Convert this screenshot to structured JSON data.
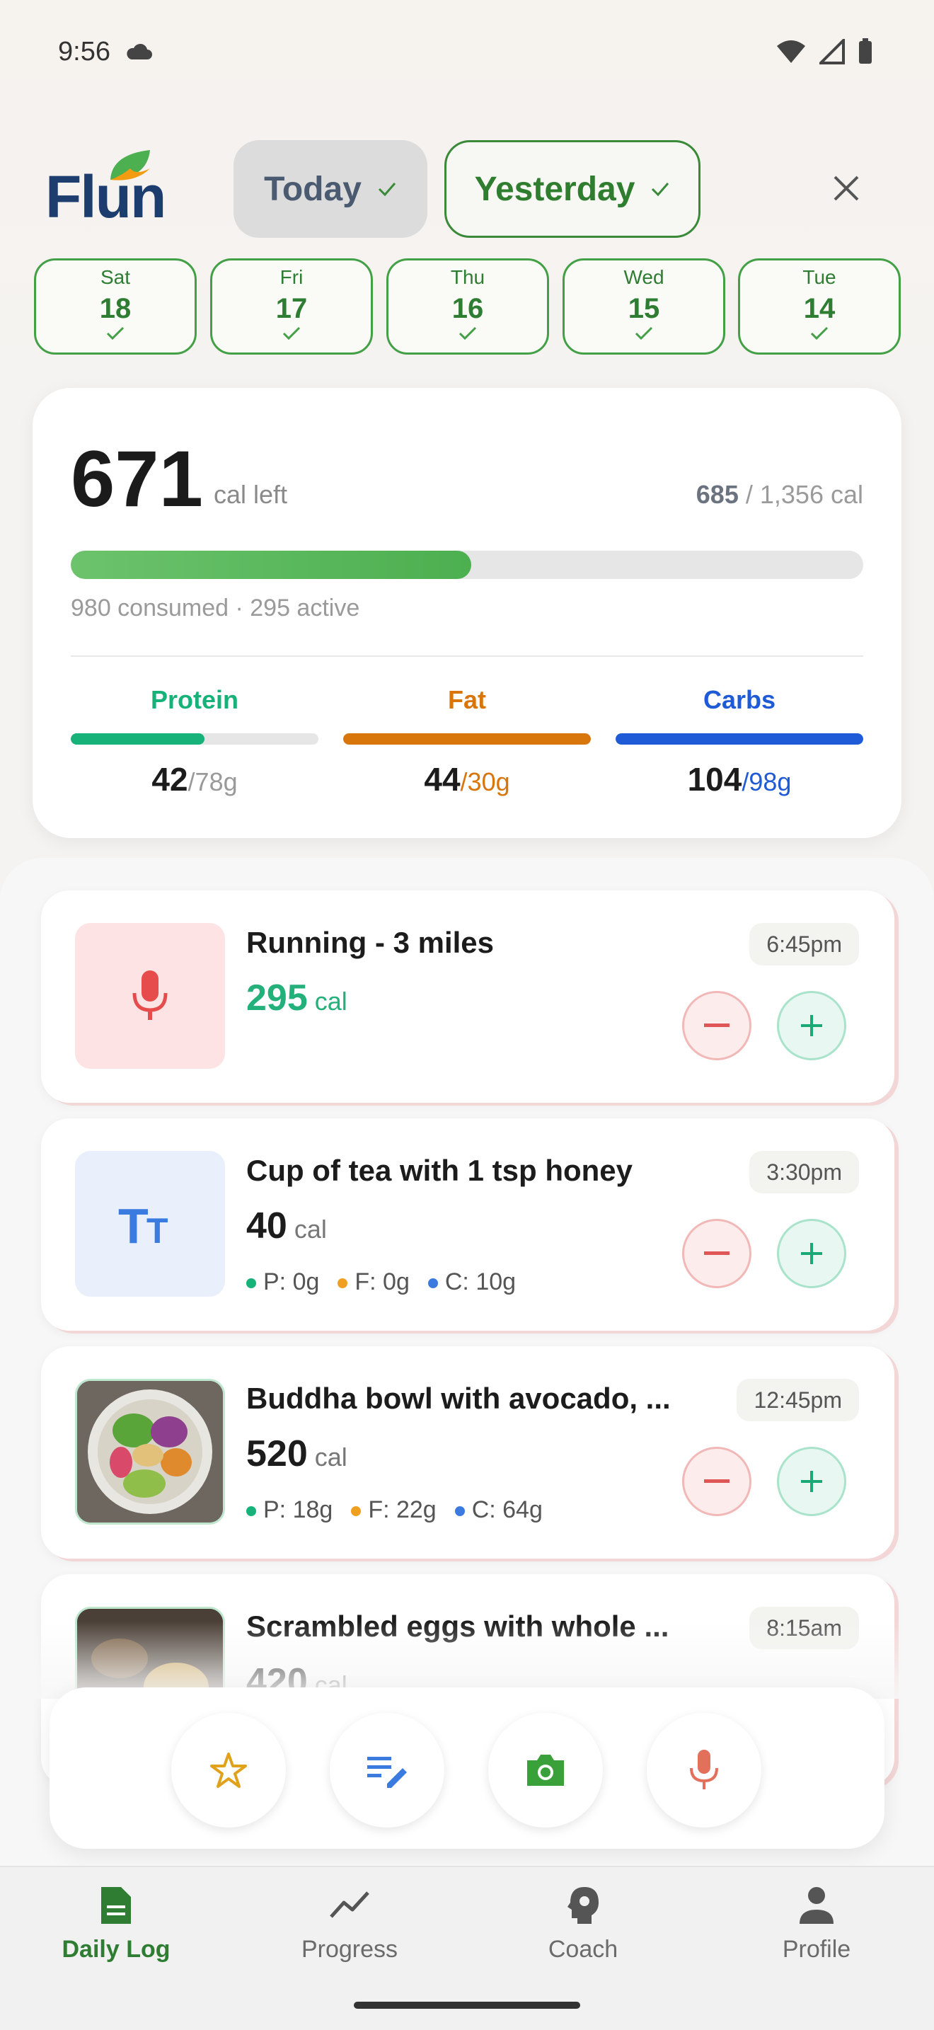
{
  "status_bar": {
    "time": "9:56"
  },
  "header": {
    "logo_text": "Flun",
    "tabs": [
      {
        "label": "Today"
      },
      {
        "label": "Yesterday"
      }
    ]
  },
  "days": [
    {
      "dow": "Sat",
      "num": "18"
    },
    {
      "dow": "Fri",
      "num": "17"
    },
    {
      "dow": "Thu",
      "num": "16"
    },
    {
      "dow": "Wed",
      "num": "15"
    },
    {
      "dow": "Tue",
      "num": "14"
    }
  ],
  "summary": {
    "calories_left": "671",
    "cal_left_label": "cal left",
    "net": "685",
    "goal": "/ 1,356 cal",
    "progress_fraction": 0.505,
    "consumed_text": "980 consumed · 295 active",
    "macros": [
      {
        "label": "Protein",
        "value": "42",
        "goal": "/78g",
        "fraction": 0.54,
        "color": "#16b27a"
      },
      {
        "label": "Fat",
        "value": "44",
        "goal": "/30g",
        "fraction": 1.0,
        "color": "#d9760b"
      },
      {
        "label": "Carbs",
        "value": "104",
        "goal": "/98g",
        "fraction": 1.0,
        "color": "#1f5bd6"
      }
    ]
  },
  "entries": [
    {
      "title": "Running - 3 miles",
      "calories": "295",
      "unit": "cal",
      "time": "6:45pm",
      "icon": "microphone-icon"
    },
    {
      "title": "Cup of tea with 1 tsp honey",
      "calories": "40",
      "unit": "cal",
      "time": "3:30pm",
      "icon": "text-icon",
      "protein": "P: 0g",
      "fat": "F: 0g",
      "carbs": "C: 10g"
    },
    {
      "title": "Buddha bowl with avocado, ...",
      "calories": "520",
      "unit": "cal",
      "time": "12:45pm",
      "icon": "food-photo",
      "protein": "P: 18g",
      "fat": "F: 22g",
      "carbs": "C: 64g"
    },
    {
      "title": "Scrambled eggs with whole ...",
      "calories": "420",
      "unit": "cal",
      "time": "8:15am",
      "icon": "food-photo"
    }
  ],
  "nav": [
    {
      "label": "Daily Log",
      "icon": "document-icon"
    },
    {
      "label": "Progress",
      "icon": "trend-icon"
    },
    {
      "label": "Coach",
      "icon": "brain-icon"
    },
    {
      "label": "Profile",
      "icon": "person-icon"
    }
  ]
}
